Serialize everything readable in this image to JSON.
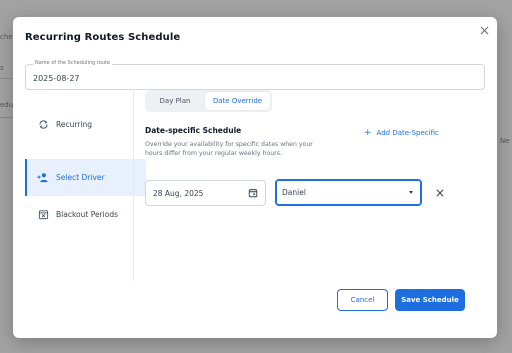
{
  "background": {
    "fragments": [
      "che",
      "s",
      "edu",
      "Ne"
    ]
  },
  "modal": {
    "title": "Recurring Routes Schedule",
    "close_icon": "close-icon"
  },
  "name_field": {
    "label": "Name of the Scheduling route",
    "value": "2025-08-27"
  },
  "sidebar": {
    "items": [
      {
        "label": "Recurring",
        "icon": "recurring-icon",
        "active": false
      },
      {
        "label": "Select Driver",
        "icon": "add-person-icon",
        "active": true
      },
      {
        "label": "Blackout Periods",
        "icon": "calendar-x-icon",
        "active": false
      }
    ]
  },
  "tabs": {
    "day_plan": "Day Plan",
    "date_override": "Date Override",
    "active": "date_override"
  },
  "section": {
    "title": "Date-specific Schedule",
    "description": "Override your availability for specific dates when your hours differ from your regular weekly hours.",
    "add_label": "Add Date-Specific"
  },
  "override_row": {
    "date": "28 Aug, 2025",
    "driver": "Daniel"
  },
  "footer": {
    "cancel_label": "Cancel",
    "save_label": "Save Schedule"
  },
  "colors": {
    "accent": "#1d6fe0",
    "active_bg": "#e8f1fb",
    "overlay": "#8d8d8d"
  }
}
